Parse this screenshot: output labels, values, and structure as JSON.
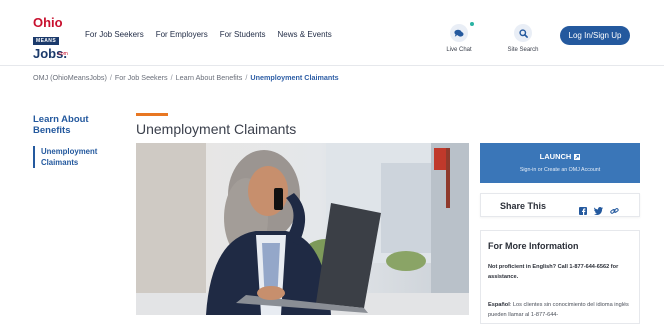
{
  "logo": {
    "line1": "Ohio",
    "line2": "MEANS",
    "line3": "Jobs.",
    "line4": ".com"
  },
  "nav": {
    "items": [
      "For Job Seekers",
      "For Employers",
      "For Students",
      "News & Events"
    ]
  },
  "header": {
    "live_chat": "Live Chat",
    "site_search": "Site Search",
    "login_label": "Log In/Sign Up"
  },
  "breadcrumb": {
    "items": [
      "OMJ (OhioMeansJobs)",
      "For Job Seekers",
      "Learn About Benefits"
    ],
    "current": "Unemployment Claimants",
    "separator": "/"
  },
  "sidebar": {
    "title": "Learn About Benefits",
    "active_item": "Unemployment Claimants"
  },
  "main": {
    "title": "Unemployment Claimants"
  },
  "launch": {
    "label": "LAUNCH",
    "sub": "Sign-in or Create an OMJ Account"
  },
  "share": {
    "label": "Share This"
  },
  "info": {
    "heading": "For More Information",
    "p1": "Not proficient in English? Call 1-877-644-6562 for assistance.",
    "p2_bold": "Español",
    "p2_rest": ": Los clientes sin conocimiento del idioma inglés pueden llamar al 1-877-644-"
  },
  "colors": {
    "brand_blue": "#24599e",
    "launch_blue": "#3a76b8",
    "accent_orange": "#e87722",
    "logo_red": "#c8102e"
  }
}
